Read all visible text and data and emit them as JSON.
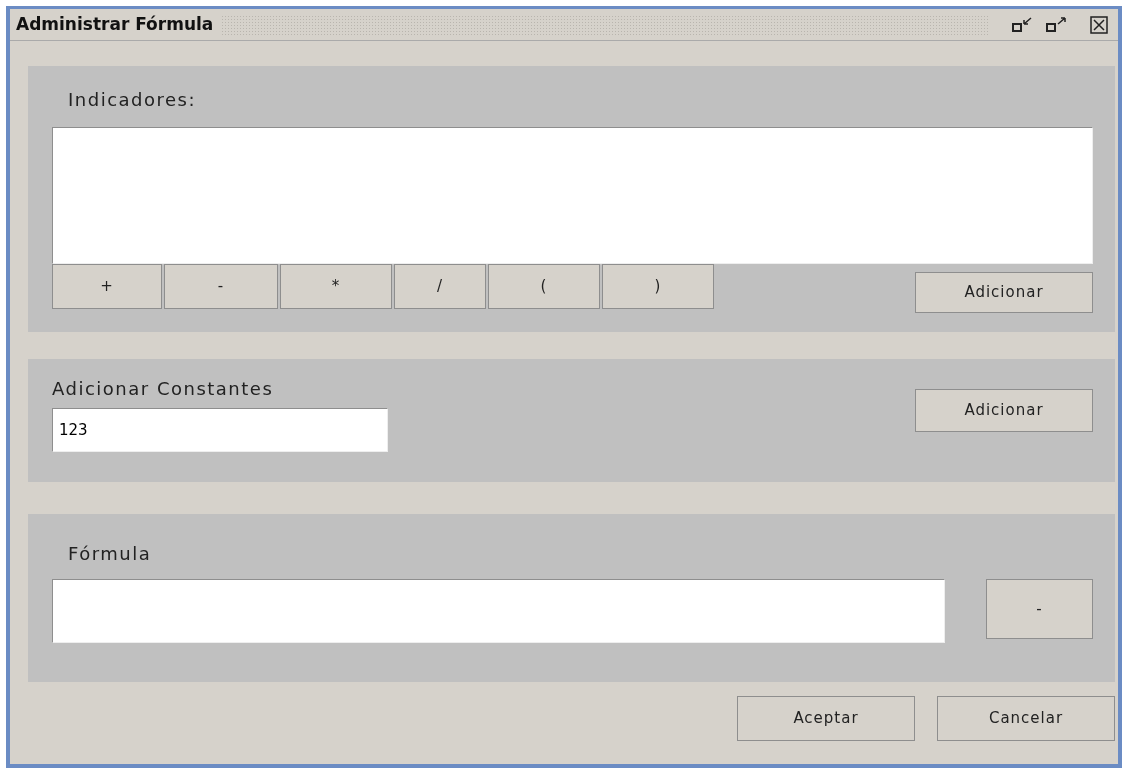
{
  "window": {
    "title": "Administrar Fórmula"
  },
  "indicators": {
    "label": "Indicadores:",
    "operators": [
      "+",
      "-",
      "*",
      "/",
      "(",
      ")"
    ],
    "add_button": "Adicionar"
  },
  "constants": {
    "label": "Adicionar Constantes",
    "value": "123",
    "add_button": "Adicionar"
  },
  "formula": {
    "label": "Fórmula",
    "remove_button": "-"
  },
  "buttons": [
    "Aceptar",
    "Cancelar"
  ]
}
